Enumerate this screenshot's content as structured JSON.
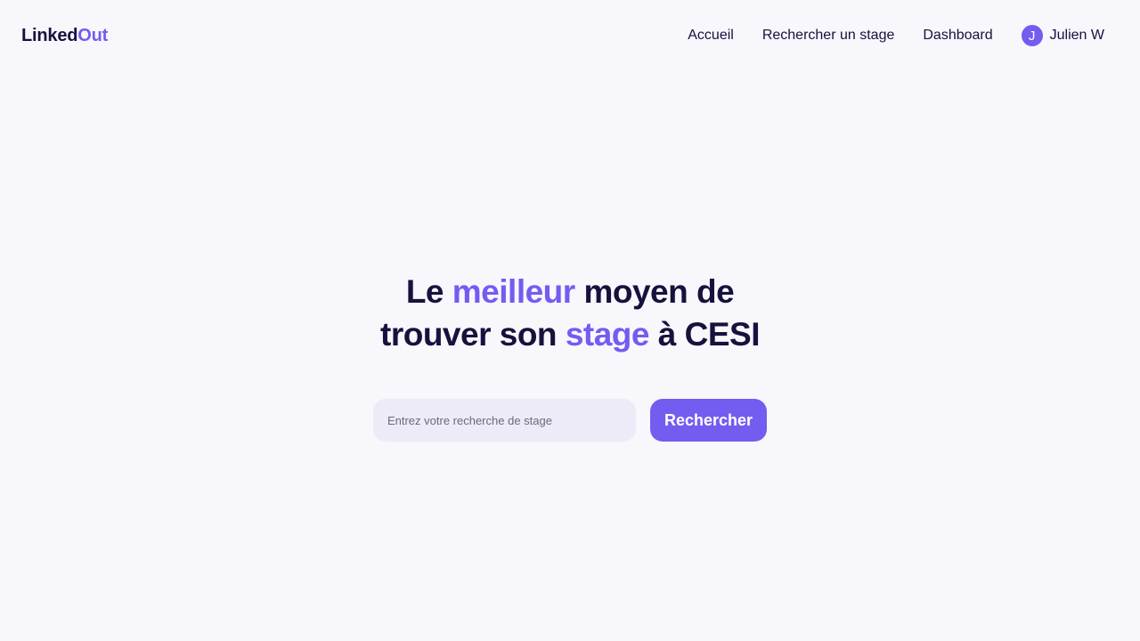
{
  "header": {
    "logo": {
      "part1": "Linked",
      "part2": "Out"
    },
    "nav": {
      "home": "Accueil",
      "search": "Rechercher un stage",
      "dashboard": "Dashboard"
    },
    "user": {
      "initial": "J",
      "name": "Julien W"
    }
  },
  "hero": {
    "title_line1": {
      "a": "Le ",
      "accent": "meilleur",
      "b": " moyen de"
    },
    "title_line2": {
      "a": "trouver son ",
      "accent": "stage",
      "b": " à CESI"
    }
  },
  "search": {
    "placeholder": "Entrez votre recherche de stage",
    "value": "",
    "button_label": "Rechercher"
  },
  "colors": {
    "background": "#f7f7fc",
    "text": "#16123d",
    "accent": "#735cf0",
    "input_background": "#edebf8"
  }
}
